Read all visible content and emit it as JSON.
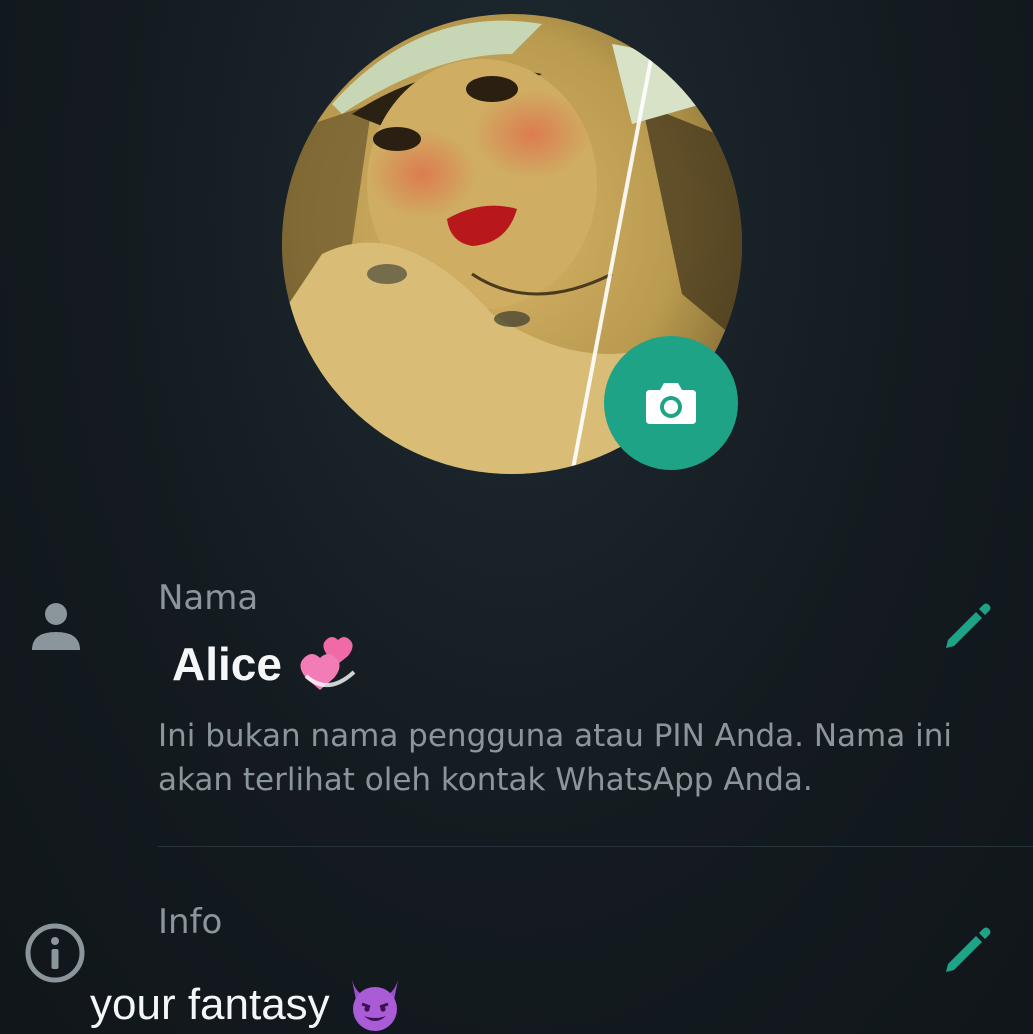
{
  "profile": {
    "photo_alt": "profile-photo",
    "camera_button": "camera-icon"
  },
  "name_section": {
    "label": "Nama",
    "value": "Alice",
    "emoji": "revolving-hearts-emoji",
    "hint": "Ini bukan nama pengguna atau PIN Anda. Nama ini akan terlihat oleh kontak WhatsApp Anda.",
    "icon": "person-icon",
    "edit_icon": "pencil-icon"
  },
  "info_section": {
    "label": "Info",
    "value": "your fantasy",
    "emoji": "smiling-devil-emoji",
    "icon": "info-icon",
    "edit_icon": "pencil-icon"
  },
  "colors": {
    "background": "#141b20",
    "accent": "#1fa386",
    "text_primary": "#f4f6f7",
    "text_secondary": "#8a969c",
    "icon_gray": "#8a969c"
  }
}
